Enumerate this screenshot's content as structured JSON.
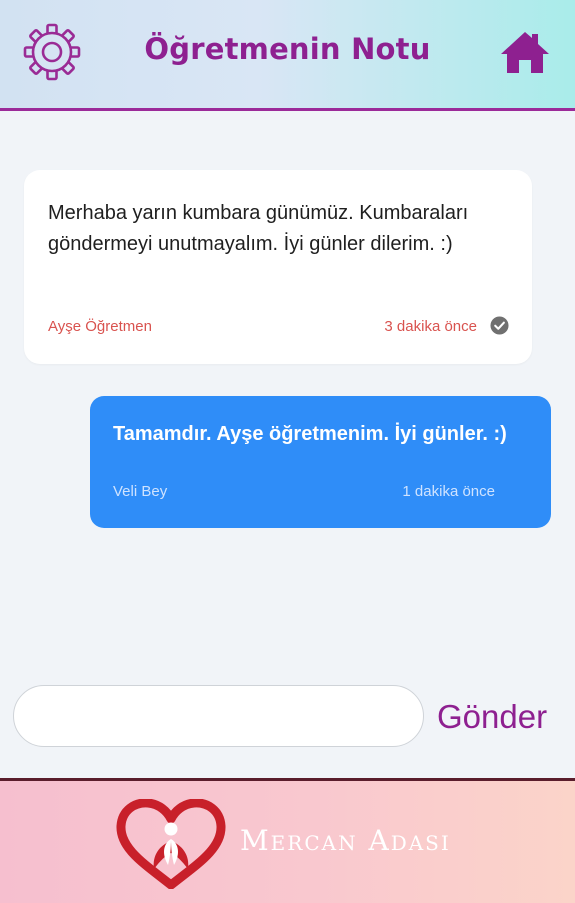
{
  "header": {
    "title": "Öğretmenin Notu",
    "left_icon": "gear-icon",
    "right_icon": "home-icon",
    "title_color": "#8e2090"
  },
  "messages": [
    {
      "direction": "incoming",
      "text": "Merhaba yarın kumbara günümüz. Kumbaraları göndermeyi unutmayalım. İyi günler dilerim. :)",
      "sender": "Ayşe Öğretmen",
      "time": "3 dakika önce",
      "status_icon": "check-circle-icon"
    },
    {
      "direction": "outgoing",
      "text": "Tamamdır. Ayşe öğretmenim. İyi günler. :)",
      "sender": "Veli Bey",
      "time": "1 dakika önce",
      "bubble_color": "#2f8df8"
    }
  ],
  "composer": {
    "value": "",
    "placeholder": "",
    "send_label": "Gönder"
  },
  "footer": {
    "brand": "Mercan Adası",
    "logo_icon": "heart-logo-icon"
  }
}
